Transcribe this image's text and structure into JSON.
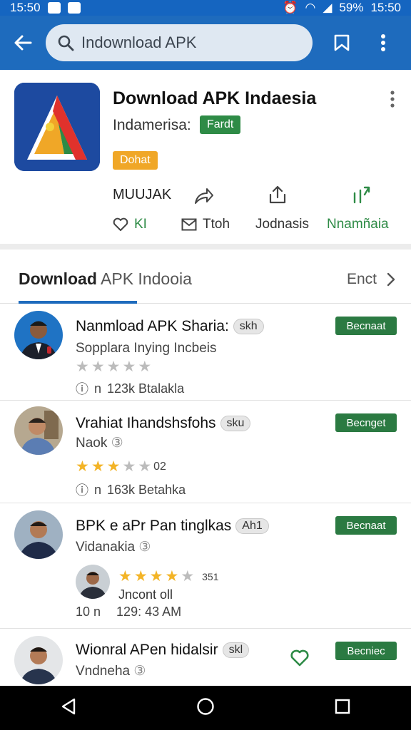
{
  "status_bar": {
    "time": "15:50",
    "battery": "59%",
    "right_time": "15:50"
  },
  "search": {
    "value": "Indownload APK"
  },
  "app": {
    "title": "Download APK Indaesia",
    "subtitle": "Indamerisa:",
    "badge_green": "Fardt",
    "badge_orange": "Dohat",
    "action_label": "MUUJAK",
    "actions": [
      {
        "label": "KI",
        "icon": "heart-icon"
      },
      {
        "label": "Ttoh",
        "icon": "mail-icon"
      },
      {
        "label": "Jodnasis",
        "icon": ""
      },
      {
        "label": "Nnamñaia",
        "icon": ""
      }
    ]
  },
  "section": {
    "title_bold": "Download",
    "title_rest": "APK Indooia",
    "more_label": "Enct"
  },
  "items": [
    {
      "title": "Nanmload APK Sharia:",
      "tag": "skh",
      "subtitle": "Sopplara Inying Incbeis",
      "meta_prefix": "n",
      "meta": "123k Btalakla",
      "button": "Becnaat",
      "rating_text": ""
    },
    {
      "title": "Vrahiat Ihandshsfohs",
      "tag": "sku",
      "subtitle": "Naok",
      "rating_text": "02",
      "meta_prefix": "n",
      "meta": "163k Betahka",
      "button": "Becnget"
    },
    {
      "title": "BPK e aPr Pan tinglkas",
      "tag": "Ah1",
      "subtitle": "Vidanakia",
      "button": "Becnaat"
    },
    {
      "title": "Wionral APen hidalsir",
      "tag": "skl",
      "subtitle": "Vndneha",
      "button": "Becniec"
    }
  ],
  "review": {
    "rating_text": "351",
    "name": "Jncont oll",
    "meta_prefix": "10 n",
    "meta": "129: 43 AM"
  },
  "colors": {
    "primary": "#1e6bbd",
    "button_green": "#2b7a42",
    "badge_orange": "#f0a727",
    "star": "#f3b427"
  }
}
